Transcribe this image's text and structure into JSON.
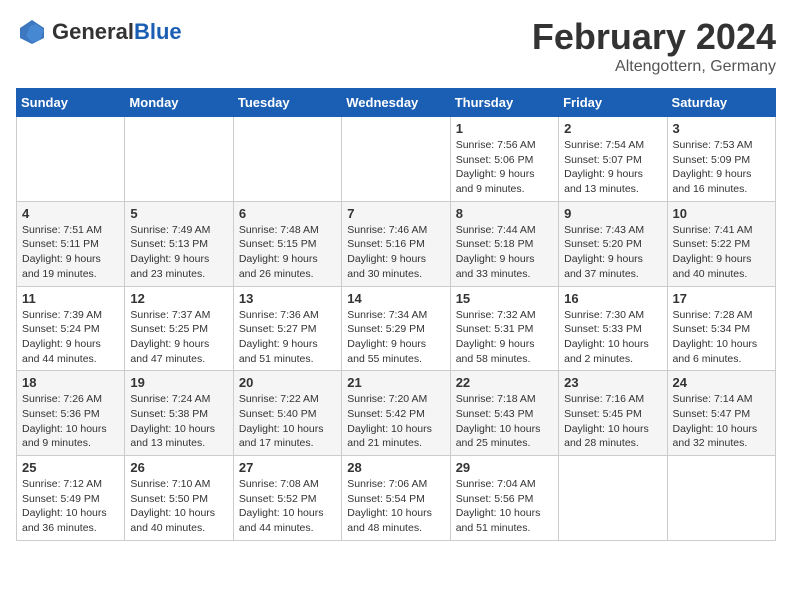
{
  "header": {
    "logo_line1": "General",
    "logo_line2": "Blue",
    "month": "February 2024",
    "location": "Altengottern, Germany"
  },
  "weekdays": [
    "Sunday",
    "Monday",
    "Tuesday",
    "Wednesday",
    "Thursday",
    "Friday",
    "Saturday"
  ],
  "weeks": [
    [
      {
        "day": "",
        "info": ""
      },
      {
        "day": "",
        "info": ""
      },
      {
        "day": "",
        "info": ""
      },
      {
        "day": "",
        "info": ""
      },
      {
        "day": "1",
        "info": "Sunrise: 7:56 AM\nSunset: 5:06 PM\nDaylight: 9 hours\nand 9 minutes."
      },
      {
        "day": "2",
        "info": "Sunrise: 7:54 AM\nSunset: 5:07 PM\nDaylight: 9 hours\nand 13 minutes."
      },
      {
        "day": "3",
        "info": "Sunrise: 7:53 AM\nSunset: 5:09 PM\nDaylight: 9 hours\nand 16 minutes."
      }
    ],
    [
      {
        "day": "4",
        "info": "Sunrise: 7:51 AM\nSunset: 5:11 PM\nDaylight: 9 hours\nand 19 minutes."
      },
      {
        "day": "5",
        "info": "Sunrise: 7:49 AM\nSunset: 5:13 PM\nDaylight: 9 hours\nand 23 minutes."
      },
      {
        "day": "6",
        "info": "Sunrise: 7:48 AM\nSunset: 5:15 PM\nDaylight: 9 hours\nand 26 minutes."
      },
      {
        "day": "7",
        "info": "Sunrise: 7:46 AM\nSunset: 5:16 PM\nDaylight: 9 hours\nand 30 minutes."
      },
      {
        "day": "8",
        "info": "Sunrise: 7:44 AM\nSunset: 5:18 PM\nDaylight: 9 hours\nand 33 minutes."
      },
      {
        "day": "9",
        "info": "Sunrise: 7:43 AM\nSunset: 5:20 PM\nDaylight: 9 hours\nand 37 minutes."
      },
      {
        "day": "10",
        "info": "Sunrise: 7:41 AM\nSunset: 5:22 PM\nDaylight: 9 hours\nand 40 minutes."
      }
    ],
    [
      {
        "day": "11",
        "info": "Sunrise: 7:39 AM\nSunset: 5:24 PM\nDaylight: 9 hours\nand 44 minutes."
      },
      {
        "day": "12",
        "info": "Sunrise: 7:37 AM\nSunset: 5:25 PM\nDaylight: 9 hours\nand 47 minutes."
      },
      {
        "day": "13",
        "info": "Sunrise: 7:36 AM\nSunset: 5:27 PM\nDaylight: 9 hours\nand 51 minutes."
      },
      {
        "day": "14",
        "info": "Sunrise: 7:34 AM\nSunset: 5:29 PM\nDaylight: 9 hours\nand 55 minutes."
      },
      {
        "day": "15",
        "info": "Sunrise: 7:32 AM\nSunset: 5:31 PM\nDaylight: 9 hours\nand 58 minutes."
      },
      {
        "day": "16",
        "info": "Sunrise: 7:30 AM\nSunset: 5:33 PM\nDaylight: 10 hours\nand 2 minutes."
      },
      {
        "day": "17",
        "info": "Sunrise: 7:28 AM\nSunset: 5:34 PM\nDaylight: 10 hours\nand 6 minutes."
      }
    ],
    [
      {
        "day": "18",
        "info": "Sunrise: 7:26 AM\nSunset: 5:36 PM\nDaylight: 10 hours\nand 9 minutes."
      },
      {
        "day": "19",
        "info": "Sunrise: 7:24 AM\nSunset: 5:38 PM\nDaylight: 10 hours\nand 13 minutes."
      },
      {
        "day": "20",
        "info": "Sunrise: 7:22 AM\nSunset: 5:40 PM\nDaylight: 10 hours\nand 17 minutes."
      },
      {
        "day": "21",
        "info": "Sunrise: 7:20 AM\nSunset: 5:42 PM\nDaylight: 10 hours\nand 21 minutes."
      },
      {
        "day": "22",
        "info": "Sunrise: 7:18 AM\nSunset: 5:43 PM\nDaylight: 10 hours\nand 25 minutes."
      },
      {
        "day": "23",
        "info": "Sunrise: 7:16 AM\nSunset: 5:45 PM\nDaylight: 10 hours\nand 28 minutes."
      },
      {
        "day": "24",
        "info": "Sunrise: 7:14 AM\nSunset: 5:47 PM\nDaylight: 10 hours\nand 32 minutes."
      }
    ],
    [
      {
        "day": "25",
        "info": "Sunrise: 7:12 AM\nSunset: 5:49 PM\nDaylight: 10 hours\nand 36 minutes."
      },
      {
        "day": "26",
        "info": "Sunrise: 7:10 AM\nSunset: 5:50 PM\nDaylight: 10 hours\nand 40 minutes."
      },
      {
        "day": "27",
        "info": "Sunrise: 7:08 AM\nSunset: 5:52 PM\nDaylight: 10 hours\nand 44 minutes."
      },
      {
        "day": "28",
        "info": "Sunrise: 7:06 AM\nSunset: 5:54 PM\nDaylight: 10 hours\nand 48 minutes."
      },
      {
        "day": "29",
        "info": "Sunrise: 7:04 AM\nSunset: 5:56 PM\nDaylight: 10 hours\nand 51 minutes."
      },
      {
        "day": "",
        "info": ""
      },
      {
        "day": "",
        "info": ""
      }
    ]
  ]
}
